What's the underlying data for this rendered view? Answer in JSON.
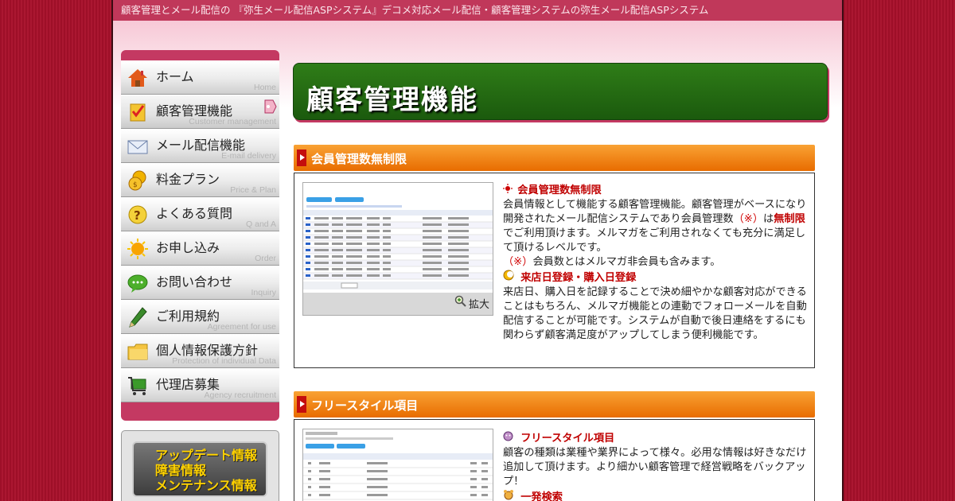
{
  "top_tagline": "顧客管理とメール配信の 『弥生メール配信ASPシステム』デコメ対応メール配信・顧客管理システムの弥生メール配信ASPシステム",
  "sidebar": {
    "items": [
      {
        "label": "ホーム",
        "sub": "Home",
        "icon": "home-icon"
      },
      {
        "label": "顧客管理機能",
        "sub": "Customer management",
        "icon": "checklist-icon"
      },
      {
        "label": "メール配信機能",
        "sub": "E-mail delivery",
        "icon": "envelope-icon"
      },
      {
        "label": "料金プラン",
        "sub": "Price & Plan",
        "icon": "coins-icon"
      },
      {
        "label": "よくある質問",
        "sub": "Q and A",
        "icon": "question-icon"
      },
      {
        "label": "お申し込み",
        "sub": "Order",
        "icon": "sun-icon"
      },
      {
        "label": "お問い合わせ",
        "sub": "Inquiry",
        "icon": "chat-icon"
      },
      {
        "label": "ご利用規約",
        "sub": "Agreement for use",
        "icon": "pen-icon"
      },
      {
        "label": "個人情報保護方針",
        "sub": "Protection of individual Data",
        "icon": "folder-icon"
      },
      {
        "label": "代理店募集",
        "sub": "Agency recruitment",
        "icon": "cart-icon"
      }
    ],
    "active_index": 1
  },
  "infobox": {
    "lines": [
      "アップデート情報",
      "障害情報",
      "メンテナンス情報"
    ]
  },
  "main": {
    "title": "顧客管理機能",
    "sections": [
      {
        "bar_label": "会員管理数無制限",
        "zoom_label": "拡大",
        "heading1": "会員管理数無制限",
        "para1_a": "会員情報として機能する顧客管理機能。顧客管理がベースになり開発されたメール配信システムであり会員管理数",
        "para1_note": "（※）",
        "para1_b": "は",
        "para1_red": "無制限",
        "para1_c": "でご利用頂けます。メルマガをご利用されなくても充分に満足して頂けるレベルです。",
        "note_mark": "（※）",
        "note_text": "会員数とはメルマガ非会員も含みます。",
        "heading2": "来店日登録・購入日登録",
        "para2": "来店日、購入日を記録することで決め細やかな顧客対応ができることはもちろん、メルマガ機能との連動でフォローメールを自動配信することが可能です。システムが自動で後日連絡をするにも関わらず顧客満足度がアップしてしまう便利機能です。"
      },
      {
        "bar_label": "フリースタイル項目",
        "heading1": "フリースタイル項目",
        "para1": "顧客の種類は業種や業界によって様々。必用な情報は好きなだけ追加して頂けます。より細かい顧客管理で経営戦略をバックアップ！",
        "heading2": "一発検索"
      }
    ]
  },
  "colors": {
    "background": "#a8102a",
    "topbar": "#c0385a",
    "sidebar": "#c43962",
    "title_green": "#2f7d18",
    "section_orange": "#f08a1a",
    "accent_red": "#c00000"
  }
}
